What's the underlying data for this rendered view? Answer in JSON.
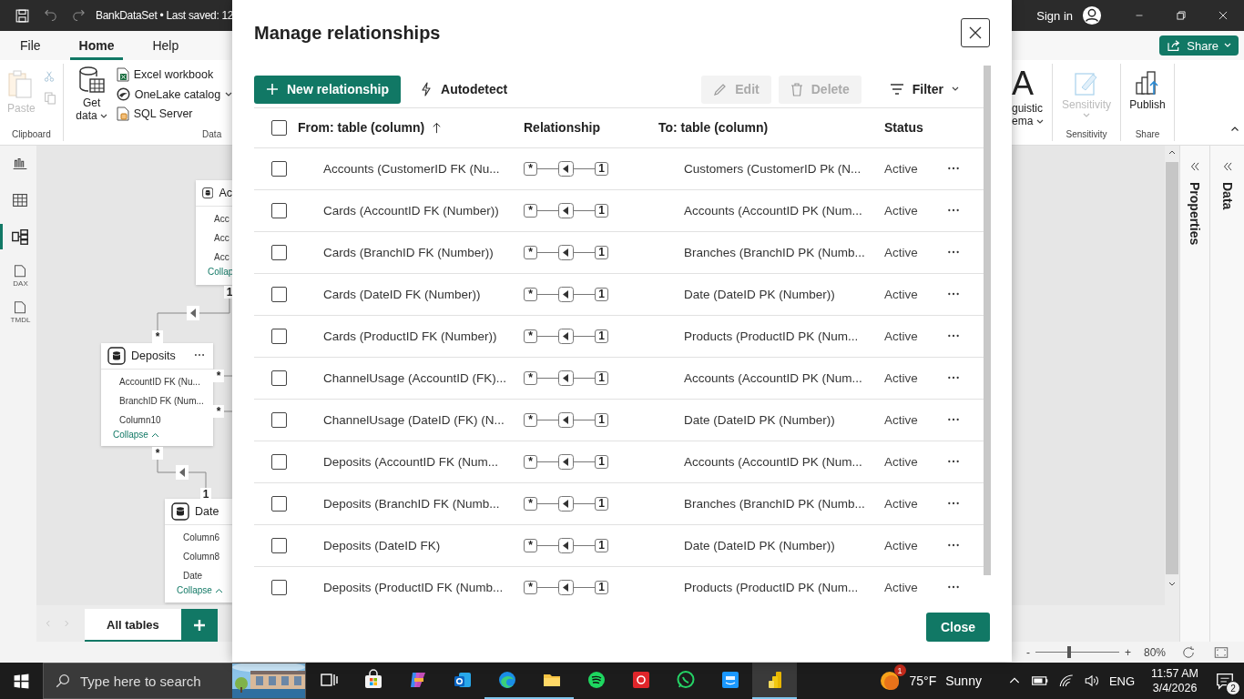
{
  "titlebar": {
    "title": "BankDataSet • Last saved: 12",
    "sign_in": "Sign in"
  },
  "ribbon_tabs": [
    {
      "label": "File",
      "selected": false
    },
    {
      "label": "Home",
      "selected": true
    },
    {
      "label": "Help",
      "selected": false
    }
  ],
  "share_button": {
    "label": "Share"
  },
  "clipboard": {
    "paste": {
      "label": "Paste",
      "disabled": true
    },
    "group": "Clipboard"
  },
  "data_group": {
    "get_data": "Get data",
    "items": [
      {
        "label": "Excel workbook",
        "kind": "excel",
        "dropdown": false
      },
      {
        "label": "OneLake catalog",
        "kind": "onelake",
        "dropdown": true
      },
      {
        "label": "SQL Server",
        "kind": "sql",
        "dropdown": false
      }
    ],
    "group": "Data"
  },
  "ribbon_right": {
    "linguistic": {
      "glyph": "A",
      "lines": [
        "guistic",
        "ema"
      ]
    },
    "sensitivity": {
      "label": "Sensitivity",
      "disabled": true
    },
    "sensitivity_group": "Sensitivity",
    "publish": {
      "label": "Publish"
    },
    "share_group": "Share"
  },
  "view_rail": [
    {
      "kind": "report",
      "selected": false
    },
    {
      "kind": "table",
      "selected": false
    },
    {
      "kind": "model",
      "selected": true
    },
    {
      "kind": "dax",
      "badge": "DAX",
      "selected": false
    },
    {
      "kind": "tmdl",
      "badge": "TMDL",
      "selected": false
    }
  ],
  "canvas": {
    "tables": [
      {
        "name": "Ac",
        "more": false,
        "columns": [
          "Acc",
          "Acc",
          "Acc"
        ],
        "collapse": "Collap"
      },
      {
        "name": "Deposits",
        "more": true,
        "columns": [
          "AccountID FK (Nu...",
          "BranchID FK (Num...",
          "Column10"
        ],
        "collapse": "Collapse"
      },
      {
        "name": "Date",
        "more": false,
        "columns": [
          "Column6",
          "Column8",
          "Date"
        ],
        "collapse": "Collapse"
      }
    ],
    "markers": [
      "1",
      "*",
      "*",
      "*",
      "*",
      "1"
    ]
  },
  "page_tabs": [
    {
      "label": "All tables",
      "selected": true
    }
  ],
  "side_panels": [
    {
      "label": "Properties"
    },
    {
      "label": "Data"
    }
  ],
  "zoom": {
    "minus": "-",
    "plus": "+",
    "level": 0.4,
    "reading": "80%"
  },
  "dialog": {
    "title": "Manage relationships",
    "toolbar": [
      {
        "label": "New relationship",
        "kind": "new",
        "disabled": false
      },
      {
        "label": "Autodetect",
        "kind": "autodetect",
        "disabled": false
      },
      {
        "label": "Edit",
        "kind": "edit",
        "disabled": true
      },
      {
        "label": "Delete",
        "kind": "delete",
        "disabled": true
      },
      {
        "label": "Filter",
        "kind": "filter",
        "disabled": false
      }
    ],
    "select_all": {
      "checked": false
    },
    "columns": [
      "From: table (column)",
      "Relationship",
      "To: table (column)",
      "Status"
    ],
    "rows": [
      {
        "checked": false,
        "from": "Accounts (CustomerID FK (Nu...",
        "many": "*",
        "one": "1",
        "to": "Customers (CustomerID Pk (N...",
        "status": "Active"
      },
      {
        "checked": false,
        "from": "Cards (AccountID FK (Number))",
        "many": "*",
        "one": "1",
        "to": "Accounts (AccountID PK (Num...",
        "status": "Active"
      },
      {
        "checked": false,
        "from": "Cards (BranchID FK (Number))",
        "many": "*",
        "one": "1",
        "to": "Branches (BranchID PK (Numb...",
        "status": "Active"
      },
      {
        "checked": false,
        "from": "Cards (DateID FK (Number))",
        "many": "*",
        "one": "1",
        "to": "Date (DateID PK (Number))",
        "status": "Active"
      },
      {
        "checked": false,
        "from": "Cards (ProductID FK (Number))",
        "many": "*",
        "one": "1",
        "to": "Products (ProductID PK (Num...",
        "status": "Active"
      },
      {
        "checked": false,
        "from": "ChannelUsage (AccountID (FK)...",
        "many": "*",
        "one": "1",
        "to": "Accounts (AccountID PK (Num...",
        "status": "Active"
      },
      {
        "checked": false,
        "from": "ChannelUsage (DateID (FK) (N...",
        "many": "*",
        "one": "1",
        "to": "Date (DateID PK (Number))",
        "status": "Active"
      },
      {
        "checked": false,
        "from": "Deposits (AccountID FK (Num...",
        "many": "*",
        "one": "1",
        "to": "Accounts (AccountID PK (Num...",
        "status": "Active"
      },
      {
        "checked": false,
        "from": "Deposits (BranchID FK (Numb...",
        "many": "*",
        "one": "1",
        "to": "Branches (BranchID PK (Numb...",
        "status": "Active"
      },
      {
        "checked": false,
        "from": "Deposits (DateID FK)",
        "many": "*",
        "one": "1",
        "to": "Date (DateID PK (Number))",
        "status": "Active"
      },
      {
        "checked": false,
        "from": "Deposits (ProductID FK (Numb...",
        "many": "*",
        "one": "1",
        "to": "Products (ProductID PK (Num...",
        "status": "Active"
      }
    ],
    "close": "Close"
  },
  "taskbar": {
    "search_placeholder": "Type here to search",
    "apps": [
      {
        "kind": "taskview",
        "running": false,
        "selected": false
      },
      {
        "kind": "store",
        "running": false,
        "selected": false
      },
      {
        "kind": "copilot",
        "running": false,
        "selected": false
      },
      {
        "kind": "outlook",
        "running": false,
        "selected": false
      },
      {
        "kind": "edge",
        "running": true,
        "selected": false
      },
      {
        "kind": "explorer",
        "running": true,
        "selected": false
      },
      {
        "kind": "spotify",
        "running": false,
        "selected": false
      },
      {
        "kind": "redapp",
        "running": false,
        "selected": false
      },
      {
        "kind": "whatsapp",
        "running": false,
        "selected": false
      },
      {
        "kind": "prime",
        "running": false,
        "selected": false
      },
      {
        "kind": "powerbi",
        "running": true,
        "selected": true
      }
    ],
    "weather": {
      "badge": "1",
      "temp": "75°F",
      "condition": "Sunny"
    },
    "lang": "ENG",
    "time": "11:57 AM",
    "date": "3/4/2026",
    "notifications": "2"
  }
}
